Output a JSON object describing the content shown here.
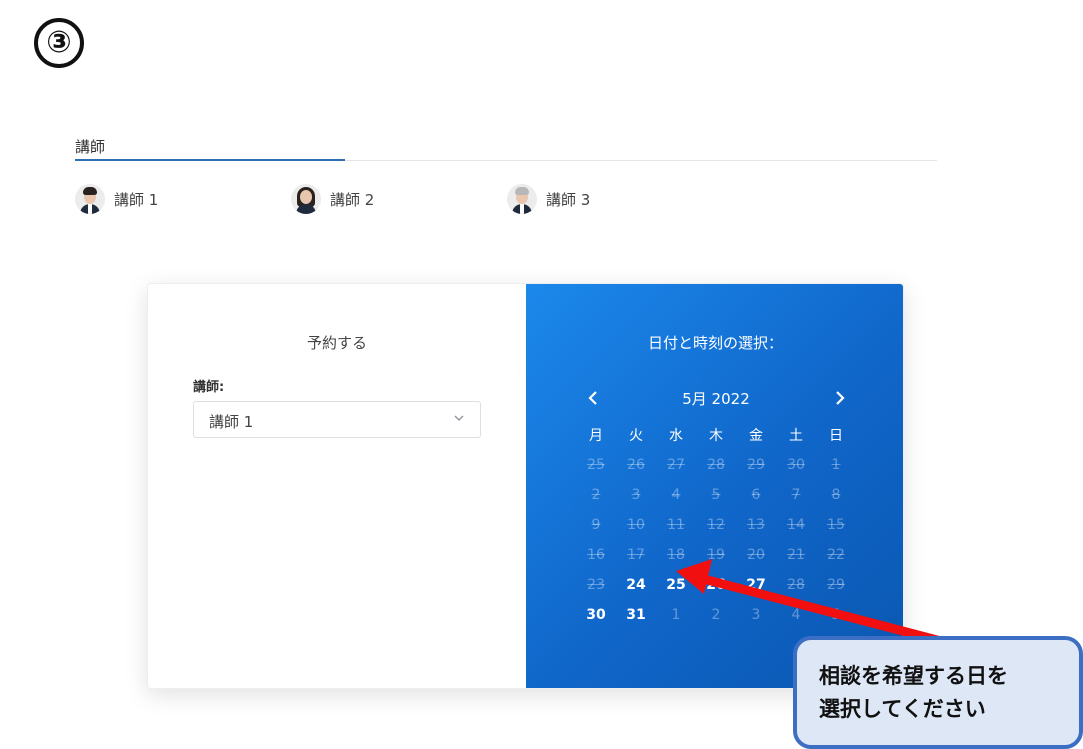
{
  "step_badge": "③",
  "tabs": {
    "active_label": "講師"
  },
  "instructors": [
    {
      "name": "講師 1",
      "avatar": "male-young-avatar"
    },
    {
      "name": "講師 2",
      "avatar": "female-avatar"
    },
    {
      "name": "講師 3",
      "avatar": "male-senior-avatar"
    }
  ],
  "booking": {
    "left_title": "予約する",
    "instructor_label": "講師:",
    "instructor_selected": "講師 1",
    "right_title": "日付と時刻の選択：",
    "calendar": {
      "month_label": "5月 2022",
      "weekdays": [
        "月",
        "火",
        "水",
        "木",
        "金",
        "土",
        "日"
      ],
      "weeks": [
        [
          {
            "d": "25",
            "s": "disabled"
          },
          {
            "d": "26",
            "s": "disabled"
          },
          {
            "d": "27",
            "s": "disabled"
          },
          {
            "d": "28",
            "s": "disabled"
          },
          {
            "d": "29",
            "s": "disabled"
          },
          {
            "d": "30",
            "s": "disabled"
          },
          {
            "d": "1",
            "s": "disabled"
          }
        ],
        [
          {
            "d": "2",
            "s": "disabled"
          },
          {
            "d": "3",
            "s": "disabled"
          },
          {
            "d": "4",
            "s": "disabled"
          },
          {
            "d": "5",
            "s": "disabled"
          },
          {
            "d": "6",
            "s": "disabled"
          },
          {
            "d": "7",
            "s": "disabled"
          },
          {
            "d": "8",
            "s": "disabled"
          }
        ],
        [
          {
            "d": "9",
            "s": "disabled"
          },
          {
            "d": "10",
            "s": "disabled"
          },
          {
            "d": "11",
            "s": "disabled"
          },
          {
            "d": "12",
            "s": "disabled"
          },
          {
            "d": "13",
            "s": "disabled"
          },
          {
            "d": "14",
            "s": "disabled"
          },
          {
            "d": "15",
            "s": "disabled"
          }
        ],
        [
          {
            "d": "16",
            "s": "disabled"
          },
          {
            "d": "17",
            "s": "disabled"
          },
          {
            "d": "18",
            "s": "disabled"
          },
          {
            "d": "19",
            "s": "disabled"
          },
          {
            "d": "20",
            "s": "disabled"
          },
          {
            "d": "21",
            "s": "disabled"
          },
          {
            "d": "22",
            "s": "disabled"
          }
        ],
        [
          {
            "d": "23",
            "s": "disabled"
          },
          {
            "d": "24",
            "s": "available"
          },
          {
            "d": "25",
            "s": "available"
          },
          {
            "d": "26",
            "s": "available"
          },
          {
            "d": "27",
            "s": "available"
          },
          {
            "d": "28",
            "s": "disabled"
          },
          {
            "d": "29",
            "s": "disabled"
          }
        ],
        [
          {
            "d": "30",
            "s": "available"
          },
          {
            "d": "31",
            "s": "available"
          },
          {
            "d": "1",
            "s": "outside"
          },
          {
            "d": "2",
            "s": "outside"
          },
          {
            "d": "3",
            "s": "outside"
          },
          {
            "d": "4",
            "s": "outside"
          },
          {
            "d": "5",
            "s": "outside"
          }
        ]
      ]
    }
  },
  "callout": {
    "line1": "相談を希望する日を",
    "line2": "選択してください"
  },
  "colors": {
    "panel_blue": "#1066c9",
    "arrow_red": "#f10f0f",
    "callout_border": "#3c6fc3",
    "callout_bg": "#dde7f6"
  }
}
